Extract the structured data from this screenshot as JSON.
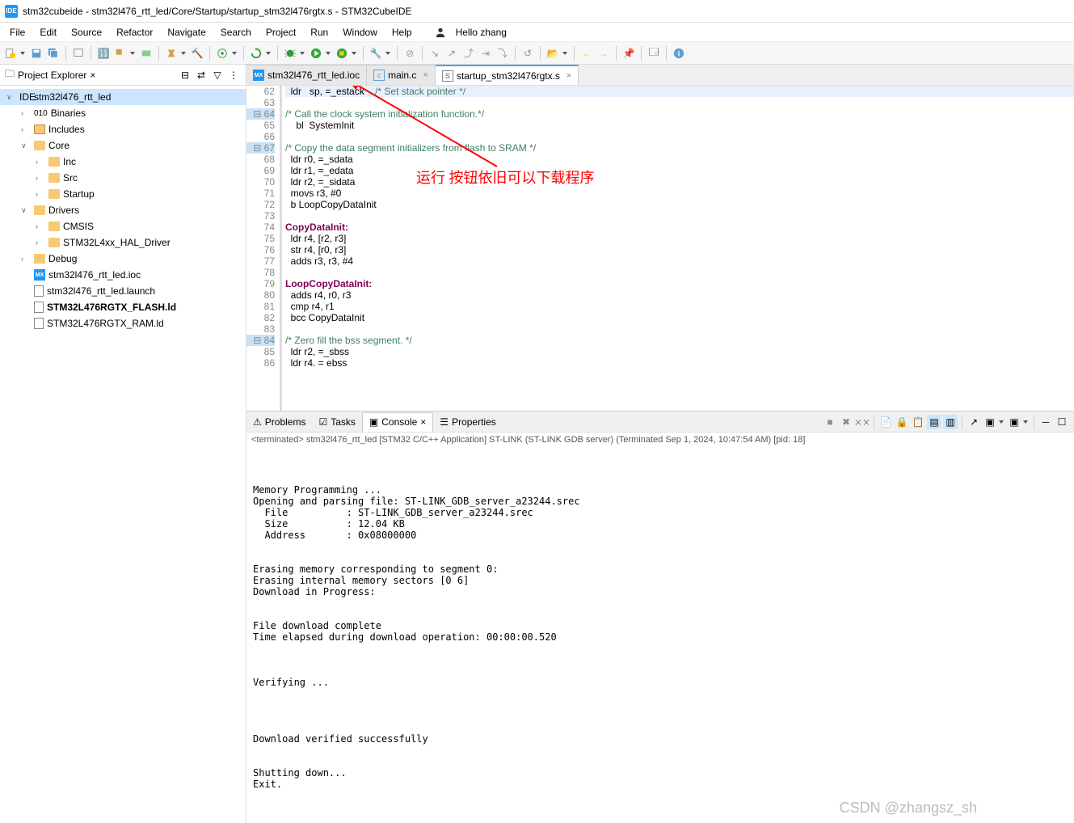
{
  "title": "stm32cubeide - stm32l476_rtt_led/Core/Startup/startup_stm32l476rgtx.s - STM32CubeIDE",
  "menu": [
    "File",
    "Edit",
    "Source",
    "Refactor",
    "Navigate",
    "Search",
    "Project",
    "Run",
    "Window",
    "Help"
  ],
  "user_greeting": "Hello zhang",
  "project_explorer": {
    "title": "Project Explorer",
    "root": "stm32l476_rtt_led",
    "items": [
      {
        "label": "Binaries",
        "type": "bin",
        "depth": 1,
        "exp": ">"
      },
      {
        "label": "Includes",
        "type": "inc",
        "depth": 1,
        "exp": ">"
      },
      {
        "label": "Core",
        "type": "folder",
        "depth": 1,
        "exp": "v"
      },
      {
        "label": "Inc",
        "type": "folder",
        "depth": 2,
        "exp": ">"
      },
      {
        "label": "Src",
        "type": "folder",
        "depth": 2,
        "exp": ">"
      },
      {
        "label": "Startup",
        "type": "folder",
        "depth": 2,
        "exp": ">"
      },
      {
        "label": "Drivers",
        "type": "folder",
        "depth": 1,
        "exp": "v"
      },
      {
        "label": "CMSIS",
        "type": "folder",
        "depth": 2,
        "exp": ">"
      },
      {
        "label": "STM32L4xx_HAL_Driver",
        "type": "folder",
        "depth": 2,
        "exp": ">"
      },
      {
        "label": "Debug",
        "type": "folder",
        "depth": 1,
        "exp": ">"
      },
      {
        "label": "stm32l476_rtt_led.ioc",
        "type": "mx",
        "depth": 1,
        "exp": ""
      },
      {
        "label": "stm32l476_rtt_led.launch",
        "type": "file",
        "depth": 1,
        "exp": ""
      },
      {
        "label": "STM32L476RGTX_FLASH.ld",
        "type": "file",
        "depth": 1,
        "exp": "",
        "bold": true
      },
      {
        "label": "STM32L476RGTX_RAM.ld",
        "type": "file",
        "depth": 1,
        "exp": ""
      }
    ]
  },
  "editor_tabs": [
    {
      "label": "stm32l476_rtt_led.ioc",
      "icon": "mx",
      "close": false
    },
    {
      "label": "main.c",
      "icon": "c",
      "close": true
    },
    {
      "label": "startup_stm32l476rgtx.s",
      "icon": "s",
      "close": true,
      "active": true
    }
  ],
  "code_lines": [
    {
      "n": 62,
      "t": "  ldr   sp, =_estack",
      "cm": "    /* Set stack pointer */",
      "hi": true
    },
    {
      "n": 63,
      "t": ""
    },
    {
      "n": 64,
      "cm": "/* Call the clock system initialization function.*/",
      "m": true
    },
    {
      "n": 65,
      "t": "    bl  SystemInit"
    },
    {
      "n": 66,
      "t": ""
    },
    {
      "n": 67,
      "cm": "/* Copy the data segment initializers from flash to SRAM */",
      "m": true
    },
    {
      "n": 68,
      "t": "  ldr r0, =_sdata"
    },
    {
      "n": 69,
      "t": "  ldr r1, =_edata"
    },
    {
      "n": 70,
      "t": "  ldr r2, =_sidata"
    },
    {
      "n": 71,
      "t": "  movs r3, #0"
    },
    {
      "n": 72,
      "t": "  b LoopCopyDataInit"
    },
    {
      "n": 73,
      "t": ""
    },
    {
      "n": 74,
      "lbl": "CopyDataInit:"
    },
    {
      "n": 75,
      "t": "  ldr r4, [r2, r3]"
    },
    {
      "n": 76,
      "t": "  str r4, [r0, r3]"
    },
    {
      "n": 77,
      "t": "  adds r3, r3, #4"
    },
    {
      "n": 78,
      "t": ""
    },
    {
      "n": 79,
      "lbl": "LoopCopyDataInit:"
    },
    {
      "n": 80,
      "t": "  adds r4, r0, r3"
    },
    {
      "n": 81,
      "t": "  cmp r4, r1"
    },
    {
      "n": 82,
      "t": "  bcc CopyDataInit"
    },
    {
      "n": 83,
      "t": ""
    },
    {
      "n": 84,
      "cm": "/* Zero fill the bss segment. */",
      "m": true
    },
    {
      "n": 85,
      "t": "  ldr r2, =_sbss"
    },
    {
      "n": 86,
      "t": "  ldr r4. = ebss"
    }
  ],
  "annotation_text": "运行 按钮依旧可以下载程序",
  "panel_tabs": [
    "Problems",
    "Tasks",
    "Console",
    "Properties"
  ],
  "console_status": "<terminated> stm32l476_rtt_led [STM32 C/C++ Application] ST-LINK (ST-LINK GDB server) (Terminated Sep 1, 2024, 10:47:54 AM) [pid: 18]",
  "console_output": "\n\n\nMemory Programming ...\nOpening and parsing file: ST-LINK_GDB_server_a23244.srec\n  File          : ST-LINK_GDB_server_a23244.srec\n  Size          : 12.04 KB\n  Address       : 0x08000000\n\n\nErasing memory corresponding to segment 0:\nErasing internal memory sectors [0 6]\nDownload in Progress:\n\n\nFile download complete\nTime elapsed during download operation: 00:00:00.520\n\n\n\nVerifying ...\n\n\n\n\nDownload verified successfully\n\n\nShutting down...\nExit.",
  "watermark": "CSDN @zhangsz_sh"
}
